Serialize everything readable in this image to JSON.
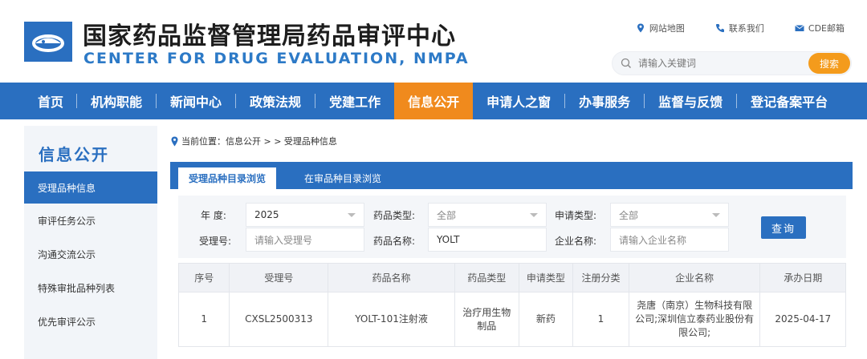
{
  "header": {
    "title_cn": "国家药品监督管理局药品审评中心",
    "title_en": "CENTER FOR DRUG EVALUATION, NMPA",
    "brand_color": "#2a6fc0",
    "toplinks": [
      {
        "label": "网站地图",
        "icon": "location-pin-icon"
      },
      {
        "label": "联系我们",
        "icon": "phone-icon"
      },
      {
        "label": "CDE邮箱",
        "icon": "mail-icon"
      }
    ],
    "search": {
      "placeholder": "请输入关键词",
      "button": "搜索",
      "button_color": "#f49b1c"
    }
  },
  "nav": {
    "items": [
      {
        "label": "首页"
      },
      {
        "label": "机构职能"
      },
      {
        "label": "新闻中心"
      },
      {
        "label": "政策法规"
      },
      {
        "label": "党建工作"
      },
      {
        "label": "信息公开",
        "active": true
      },
      {
        "label": "申请人之窗"
      },
      {
        "label": "办事服务"
      },
      {
        "label": "监督与反馈"
      },
      {
        "label": "登记备案平台"
      }
    ],
    "active_color": "#f08a1d"
  },
  "sidebar": {
    "title": "信息公开",
    "items": [
      {
        "label": "受理品种信息",
        "active": true
      },
      {
        "label": "审评任务公示"
      },
      {
        "label": "沟通交流公示"
      },
      {
        "label": "特殊审批品种列表"
      },
      {
        "label": "优先审评公示"
      }
    ]
  },
  "breadcrumb": {
    "text": "当前位置：信息公开 > > 受理品种信息"
  },
  "tabs": [
    {
      "label": "受理品种目录浏览",
      "active": true
    },
    {
      "label": "在审品种目录浏览"
    }
  ],
  "filter": {
    "year_label": "年  度:",
    "year_value": "2025",
    "drug_type_label": "药品类型:",
    "drug_type_value": "全部",
    "apply_type_label": "申请类型:",
    "apply_type_value": "全部",
    "accept_no_label": "受理号:",
    "accept_no_placeholder": "请输入受理号",
    "drug_name_label": "药品名称:",
    "drug_name_value": "YOLT",
    "company_label": "企业名称:",
    "company_placeholder": "请输入企业名称",
    "query_button": "查询"
  },
  "table": {
    "headers": [
      "序号",
      "受理号",
      "药品名称",
      "药品类型",
      "申请类型",
      "注册分类",
      "企业名称",
      "承办日期"
    ],
    "rows": [
      [
        "1",
        "CXSL2500313",
        "YOLT-101注射液",
        "治疗用生物制品",
        "新药",
        "1",
        "尧唐（南京）生物科技有限公司;深圳信立泰药业股份有限公司;",
        "2025-04-17"
      ]
    ]
  }
}
